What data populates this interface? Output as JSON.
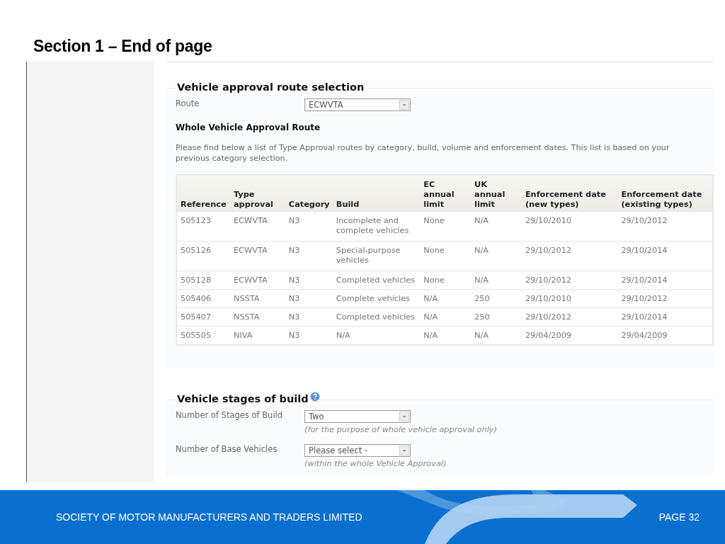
{
  "slide_title": "Section 1 – End of page",
  "route_section": {
    "legend": "Vehicle approval route selection",
    "route_label": "Route",
    "route_value": "ECWVTA",
    "subheading": "Whole Vehicle Approval Route",
    "description": "Please find below a list of Type Approval routes by category, build, volume and enforcement dates. This list is based on your previous category selection."
  },
  "table": {
    "columns": [
      "Reference",
      "Type approval",
      "Category",
      "Build",
      "EC annual limit",
      "UK annual limit",
      "Enforcement date (new types)",
      "Enforcement date (existing types)"
    ],
    "rows": [
      [
        "505123",
        "ECWVTA",
        "N3",
        "Incomplete and complete vehicles",
        "None",
        "N/A",
        "29/10/2010",
        "29/10/2012"
      ],
      [
        "505126",
        "ECWVTA",
        "N3",
        "Special-purpose vehicles",
        "None",
        "N/A",
        "29/10/2012",
        "29/10/2014"
      ],
      [
        "505128",
        "ECWVTA",
        "N3",
        "Completed vehicles",
        "None",
        "N/A",
        "29/10/2012",
        "29/10/2014"
      ],
      [
        "505406",
        "NSSTA",
        "N3",
        "Complete vehicles",
        "N/A",
        "250",
        "29/10/2010",
        "29/10/2012"
      ],
      [
        "505407",
        "NSSTA",
        "N3",
        "Completed vehicles",
        "N/A",
        "250",
        "29/10/2012",
        "29/10/2014"
      ],
      [
        "505505",
        "NIVA",
        "N3",
        "N/A",
        "N/A",
        "N/A",
        "29/04/2009",
        "29/04/2009"
      ]
    ]
  },
  "stages_section": {
    "legend": "Vehicle stages of build",
    "fields": [
      {
        "label": "Number of Stages of Build",
        "value": "Two",
        "note": "(for the purpose of whole vehicle approval only)"
      },
      {
        "label": "Number of Base Vehicles",
        "value": "Please select -",
        "note": "(within the whole Vehicle Approval)"
      }
    ]
  },
  "footer": {
    "company": "SOCIETY OF MOTOR MANUFACTURERS AND TRADERS LIMITED",
    "page": "PAGE 32"
  }
}
